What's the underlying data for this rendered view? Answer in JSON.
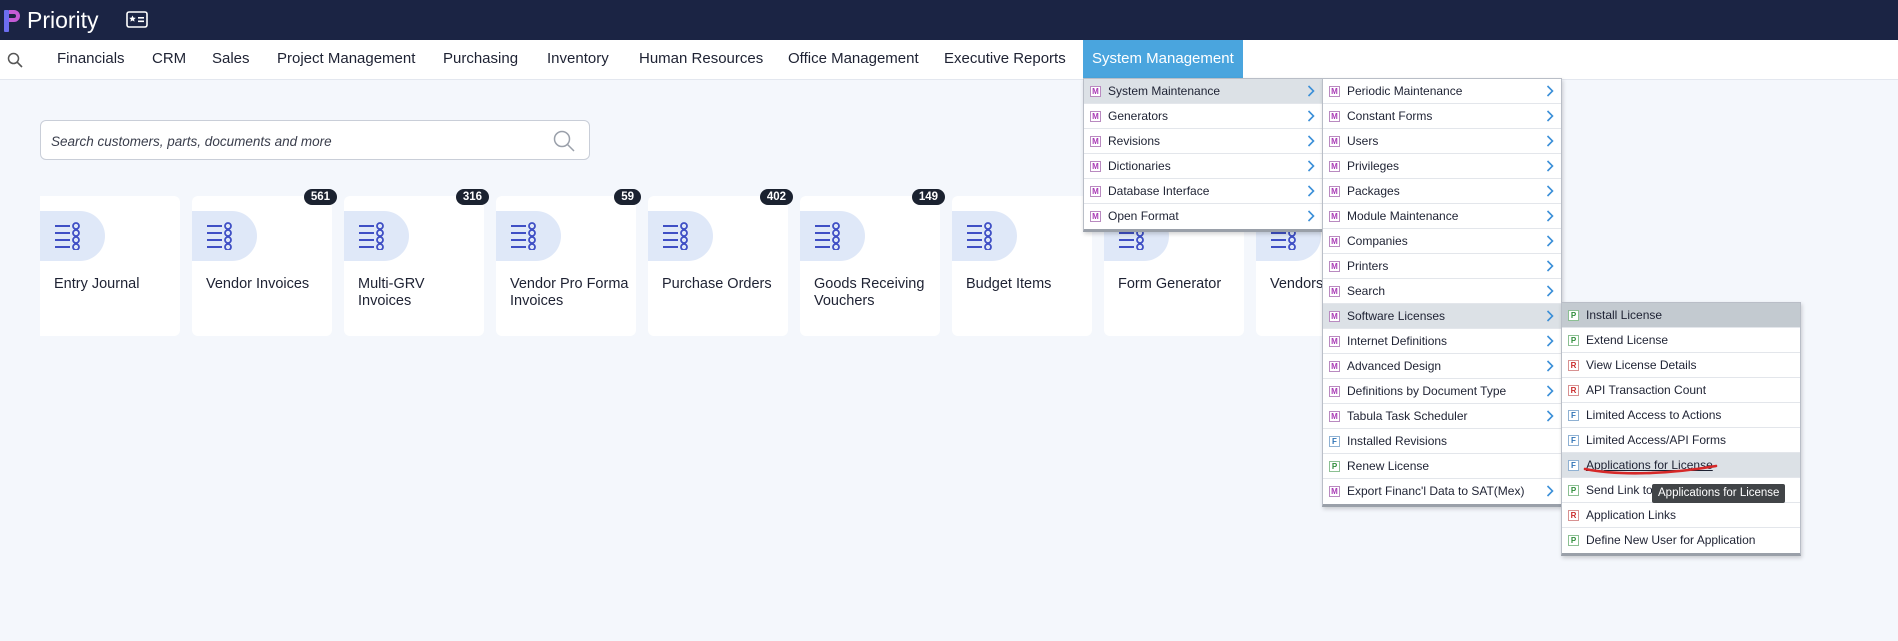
{
  "app": {
    "title": "Priority"
  },
  "nav": {
    "items": [
      "Financials",
      "CRM",
      "Sales",
      "Project Management",
      "Purchasing",
      "Inventory",
      "Human Resources",
      "Office Management",
      "Executive Reports",
      "System Management"
    ],
    "active": "System Management"
  },
  "search": {
    "placeholder": "Search customers, parts, documents and more"
  },
  "tiles": [
    {
      "label": "Entry Journal",
      "badge": ""
    },
    {
      "label": "Vendor Invoices",
      "badge": "561"
    },
    {
      "label": "Multi-GRV Invoices",
      "badge": "316"
    },
    {
      "label": "Vendor Pro Forma Invoices",
      "badge": "59"
    },
    {
      "label": "Purchase Orders",
      "badge": "402"
    },
    {
      "label": "Goods Receiving Vouchers",
      "badge": "149"
    },
    {
      "label": "Budget Items",
      "badge": ""
    },
    {
      "label": "Form Generator",
      "badge": ""
    },
    {
      "label": "Vendors",
      "badge": ""
    }
  ],
  "menu1": [
    {
      "type": "M",
      "label": "System Maintenance",
      "sub": true
    },
    {
      "type": "M",
      "label": "Generators",
      "sub": true
    },
    {
      "type": "M",
      "label": "Revisions",
      "sub": true
    },
    {
      "type": "M",
      "label": "Dictionaries",
      "sub": true
    },
    {
      "type": "M",
      "label": "Database Interface",
      "sub": true
    },
    {
      "type": "M",
      "label": "Open Format",
      "sub": true
    }
  ],
  "menu2": [
    {
      "type": "M",
      "label": "Periodic Maintenance",
      "sub": true
    },
    {
      "type": "M",
      "label": "Constant Forms",
      "sub": true
    },
    {
      "type": "M",
      "label": "Users",
      "sub": true
    },
    {
      "type": "M",
      "label": "Privileges",
      "sub": true
    },
    {
      "type": "M",
      "label": "Packages",
      "sub": true
    },
    {
      "type": "M",
      "label": "Module Maintenance",
      "sub": true
    },
    {
      "type": "M",
      "label": "Companies",
      "sub": true
    },
    {
      "type": "M",
      "label": "Printers",
      "sub": true
    },
    {
      "type": "M",
      "label": "Search",
      "sub": true
    },
    {
      "type": "M",
      "label": "Software Licenses",
      "sub": true
    },
    {
      "type": "M",
      "label": "Internet Definitions",
      "sub": true
    },
    {
      "type": "M",
      "label": "Advanced Design",
      "sub": true
    },
    {
      "type": "M",
      "label": "Definitions by Document Type",
      "sub": true
    },
    {
      "type": "M",
      "label": "Tabula Task Scheduler",
      "sub": true
    },
    {
      "type": "F",
      "label": "Installed Revisions",
      "sub": false
    },
    {
      "type": "P",
      "label": "Renew License",
      "sub": false
    },
    {
      "type": "M",
      "label": "Export Financ'l Data to SAT(Mex)",
      "sub": true
    }
  ],
  "menu3": [
    {
      "type": "P",
      "label": "Install License",
      "sub": false
    },
    {
      "type": "P",
      "label": "Extend License",
      "sub": false
    },
    {
      "type": "R",
      "label": "View License Details",
      "sub": false
    },
    {
      "type": "R",
      "label": "API Transaction Count",
      "sub": false
    },
    {
      "type": "F",
      "label": "Limited Access to Actions",
      "sub": false
    },
    {
      "type": "F",
      "label": "Limited Access/API Forms",
      "sub": false
    },
    {
      "type": "F",
      "label": "Applications for License",
      "sub": false
    },
    {
      "type": "P",
      "label": "Send Link to",
      "sub": false
    },
    {
      "type": "R",
      "label": "Application Links",
      "sub": false
    },
    {
      "type": "P",
      "label": "Define New User for Application",
      "sub": false
    }
  ],
  "tooltip": "Applications for License",
  "colors": {
    "topbar": "#1b2444",
    "active_tab": "#4aa5de",
    "annotation": "#d62828"
  }
}
